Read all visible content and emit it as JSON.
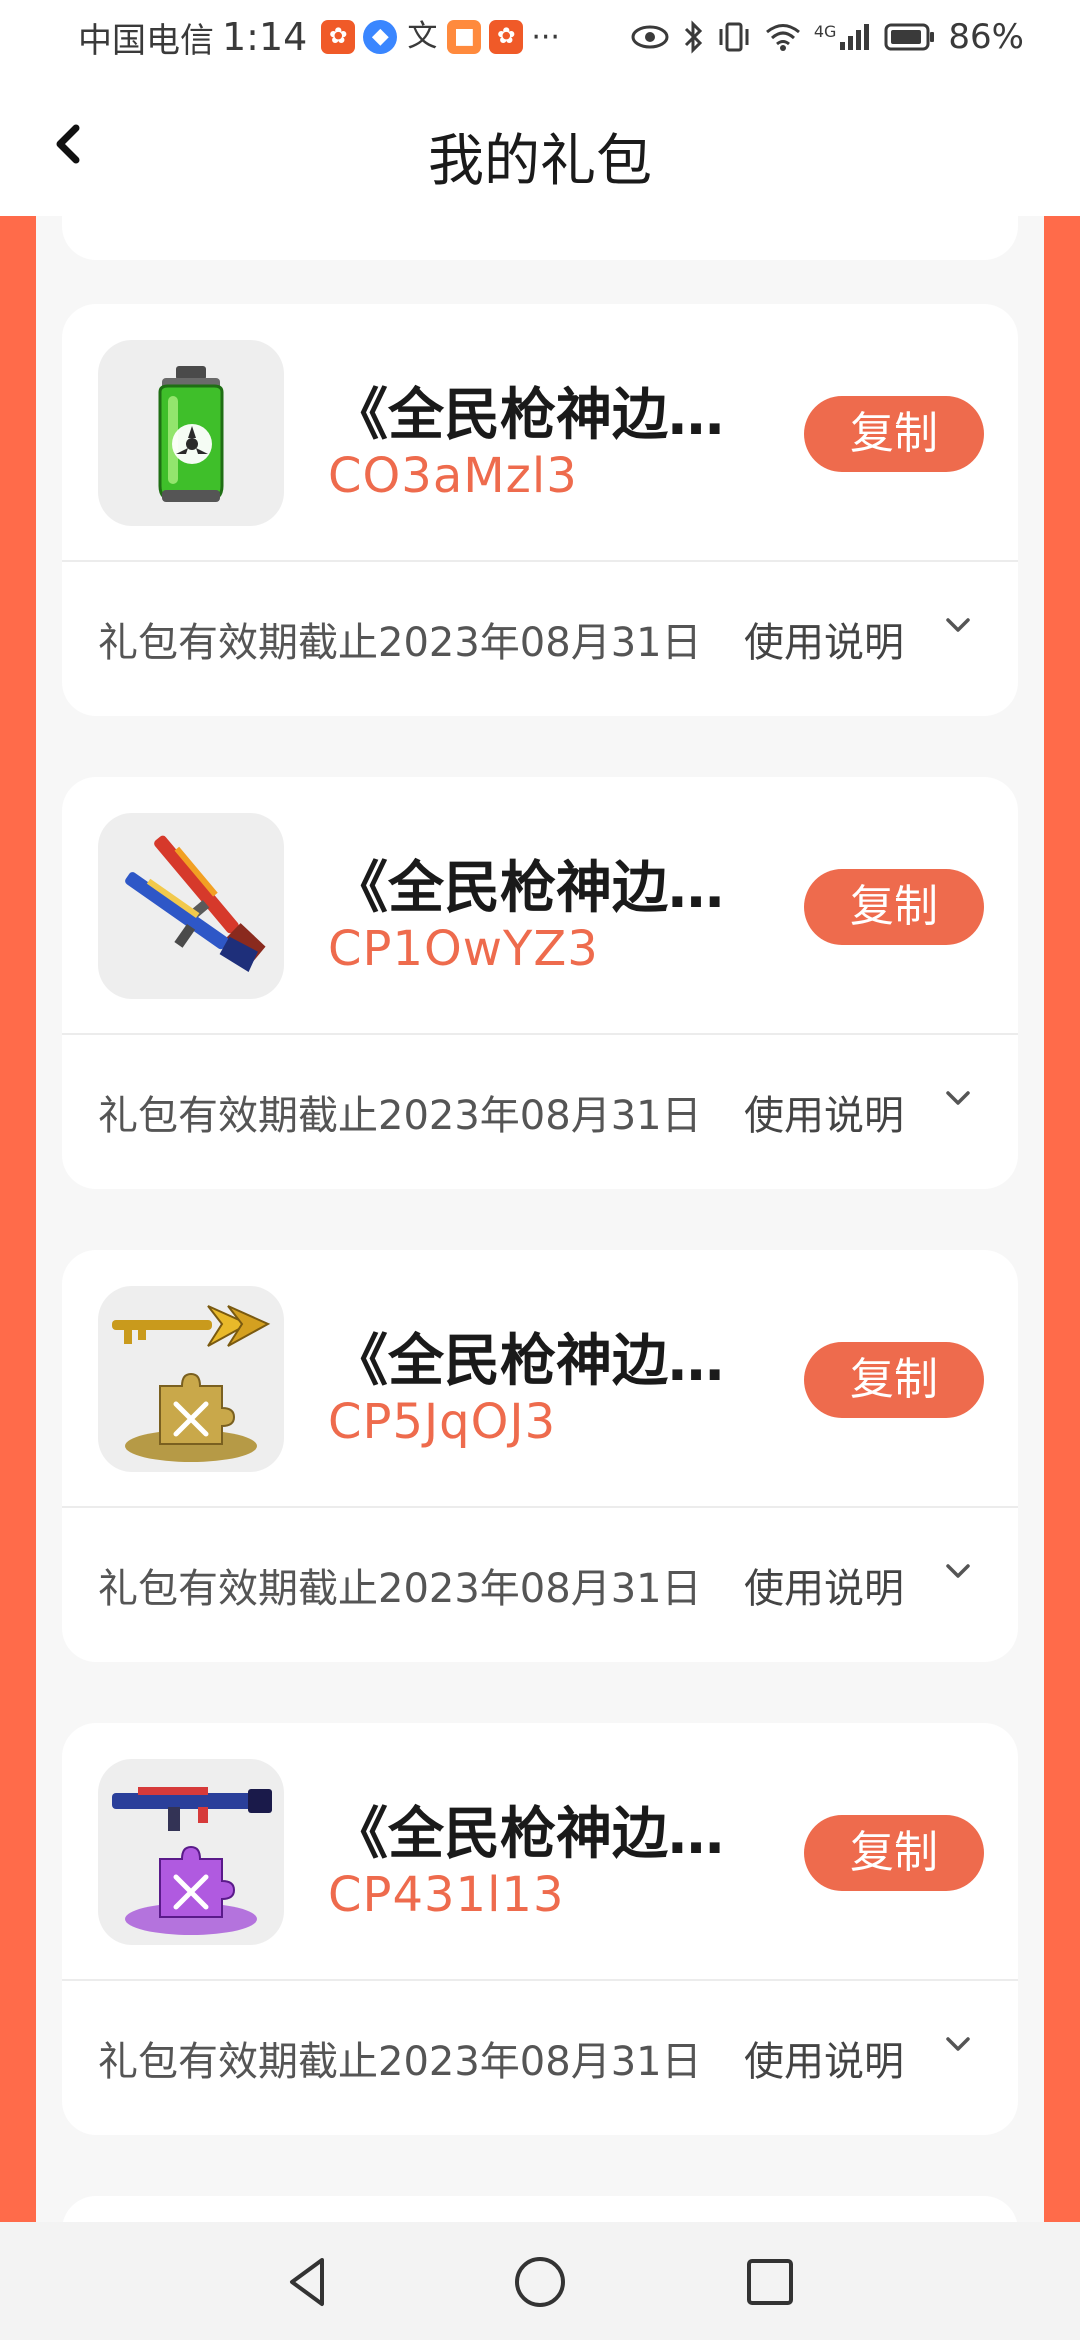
{
  "status_bar": {
    "carrier": "中国电信",
    "time": "1:14",
    "network": "4G",
    "battery": "86%"
  },
  "header": {
    "title": "我的礼包"
  },
  "gifts": [
    {
      "title": "《全民枪神边…",
      "code": "CO3aMzl3",
      "button": "复制",
      "validity": "礼包有效期截止2023年08月31日",
      "usage": "使用说明",
      "image": "green-biohazard-bottle"
    },
    {
      "title": "《全民枪神边…",
      "code": "CP1OwYZ3",
      "button": "复制",
      "validity": "礼包有效期截止2023年08月31日",
      "usage": "使用说明",
      "image": "twin-shotguns"
    },
    {
      "title": "《全民枪神边…",
      "code": "CP5JqOJ3",
      "button": "复制",
      "validity": "礼包有效期截止2023年08月31日",
      "usage": "使用说明",
      "image": "golden-key-and-puzzle-piece"
    },
    {
      "title": "《全民枪神边…",
      "code": "CP431l13",
      "button": "复制",
      "validity": "礼包有效期截止2023年08月31日",
      "usage": "使用说明",
      "image": "rifle-and-purple-puzzle-piece"
    }
  ],
  "colors": {
    "accent": "#ee6b4d",
    "side_border": "#ff6b4a",
    "page_bg": "#f7f7f7"
  }
}
